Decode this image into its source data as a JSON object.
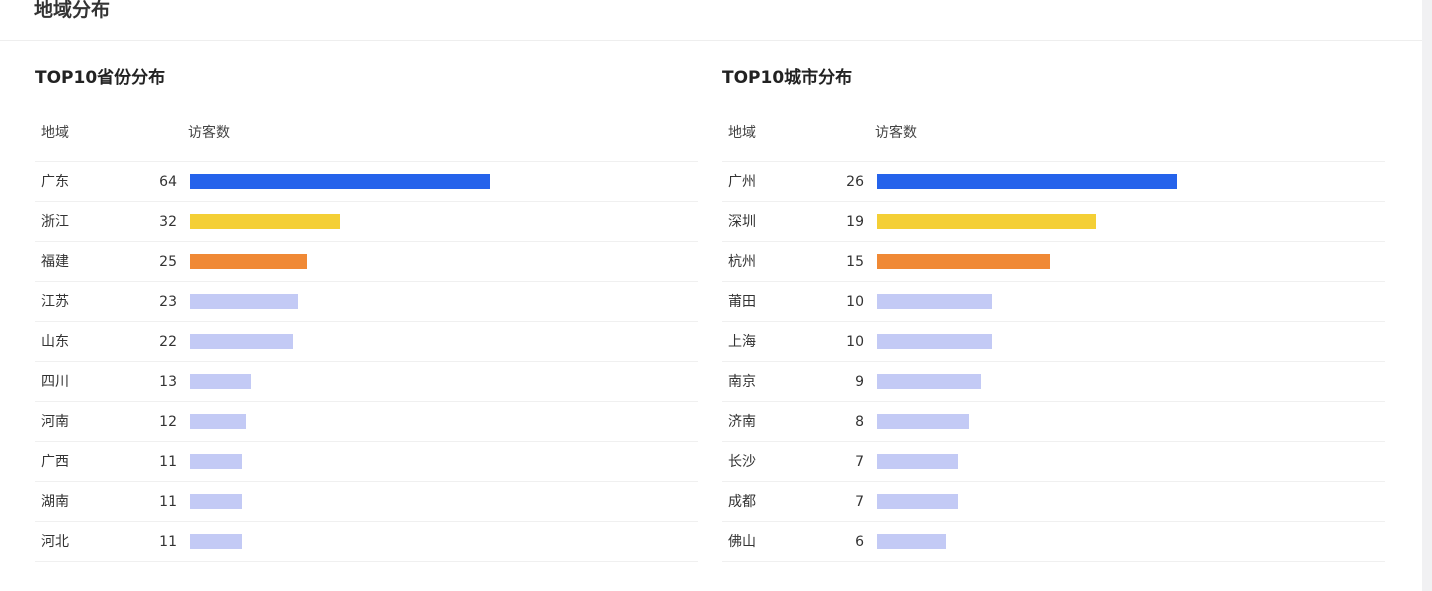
{
  "page": {
    "title": "地域分布"
  },
  "colors": {
    "first": "#2563eb",
    "second": "#f4cf35",
    "third": "#f08935",
    "rest": "#c3caf5"
  },
  "chart_data": [
    {
      "type": "bar",
      "orientation": "horizontal",
      "title": "TOP10省份分布",
      "region_label": "地域",
      "value_label": "访客数",
      "categories": [
        "广东",
        "浙江",
        "福建",
        "江苏",
        "山东",
        "四川",
        "河南",
        "广西",
        "湖南",
        "河北"
      ],
      "values": [
        64,
        32,
        25,
        23,
        22,
        13,
        12,
        11,
        11,
        11
      ]
    },
    {
      "type": "bar",
      "orientation": "horizontal",
      "title": "TOP10城市分布",
      "region_label": "地域",
      "value_label": "访客数",
      "categories": [
        "广州",
        "深圳",
        "杭州",
        "莆田",
        "上海",
        "南京",
        "济南",
        "长沙",
        "成都",
        "佛山"
      ],
      "values": [
        26,
        19,
        15,
        10,
        10,
        9,
        8,
        7,
        7,
        6
      ]
    }
  ]
}
